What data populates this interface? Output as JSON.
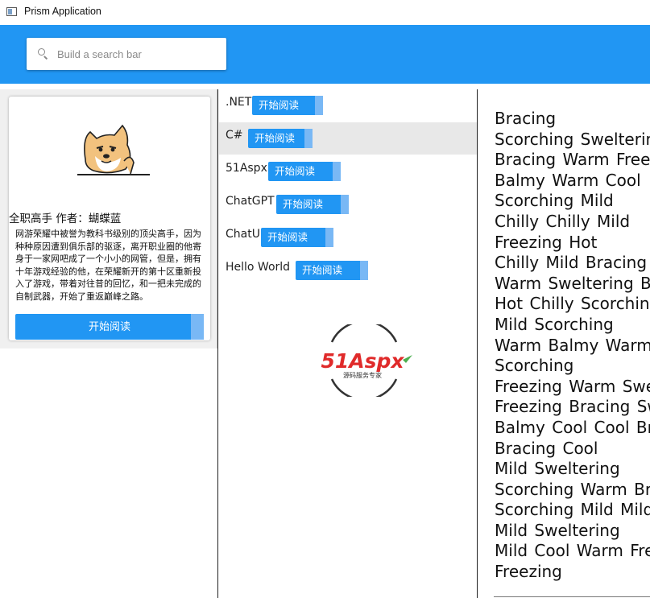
{
  "window": {
    "title": "Prism Application"
  },
  "search": {
    "placeholder": "Build a search bar",
    "value": ""
  },
  "book": {
    "meta": "全职高手  作者：蝴蝶蓝",
    "description": "网游荣耀中被誉为教科书级别的顶尖高手，因为种种原因遭到俱乐部的驱逐，离开职业圈的他寄身于一家网吧成了一个小小的网管，但是，拥有十年游戏经验的他，在荣耀新开的第十区重新投入了游戏，带着对往昔的回忆，和一把未完成的自制武器，开始了重返巅峰之路。",
    "read_label": "开始阅读"
  },
  "list": {
    "items": [
      {
        "label": ".NET",
        "button": "开始阅读"
      },
      {
        "label": "C#",
        "button": "开始阅读"
      },
      {
        "label": "51Aspx",
        "button": "开始阅读"
      },
      {
        "label": "ChatGPT",
        "button": "开始阅读"
      },
      {
        "label": "ChatUI",
        "button": "开始阅读"
      },
      {
        "label": "Hello World",
        "button": "开始阅读"
      }
    ],
    "selected_index": 1
  },
  "logo": {
    "brand": "51Aspx",
    "tagline": "源码服务专家",
    "colors": {
      "red": "#e02a2a",
      "green": "#4caf50",
      "ring": "#333333"
    }
  },
  "words": [
    "Bracing",
    "Scorching Sweltering",
    "Bracing Warm Freezing",
    "Balmy  Warm  Cool",
    "Scorching Mild",
    "Chilly  Chilly  Mild",
    "Freezing Hot",
    "Chilly  Mild  Bracing",
    "Warm Sweltering Balmy",
    "Hot Chilly Scorching",
    "Mild Scorching",
    "Warm  Balmy  Warm",
    "Scorching",
    "Freezing Warm Sweltering",
    "Freezing Bracing Sweltering",
    "Balmy  Cool  Cool  Bracing",
    "Bracing Cool",
    "Mild    Sweltering",
    "Scorching Warm Bracing",
    "Scorching  Mild  Mild",
    "Mild Sweltering",
    "Mild Cool Warm Freezing",
    "Freezing"
  ],
  "colors": {
    "accent": "#2196f3",
    "accent_light": "#79b8f5",
    "selected_row": "#e8e8e8"
  }
}
